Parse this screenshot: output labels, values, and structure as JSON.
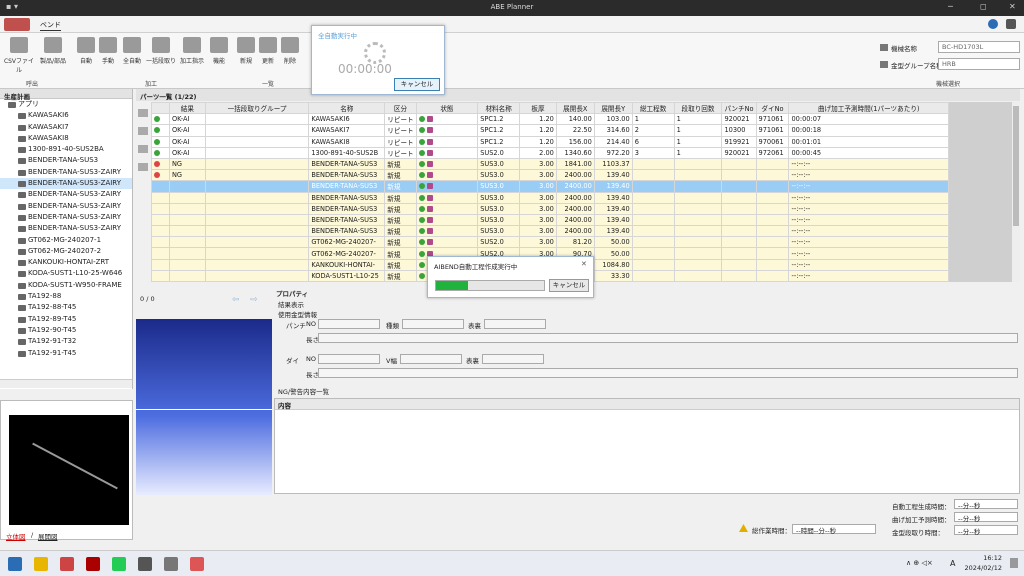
{
  "app": {
    "title": "ABE Planner",
    "win_min": "─",
    "win_max": "◻",
    "win_close": "✕"
  },
  "ribbon": {
    "tab": "ベンド",
    "buttons": [
      "CSVファイル",
      "製品/部品",
      "自動",
      "手動",
      "全自動",
      "一括段取り",
      "加工指示",
      "機能",
      "新規",
      "更新",
      "削除"
    ],
    "groups": {
      "g1": "呼出",
      "g2": "加工",
      "g3": "一覧",
      "g4": "機械選択"
    },
    "machine_label": "機械名称",
    "machine_value": "BC-HD1703L",
    "diegroup_label": "金型グループ名称",
    "diegroup_value": "HRB"
  },
  "left": {
    "header": "生産計画",
    "root": "アプリ",
    "items": [
      "KAWASAKI6",
      "KAWASAKI7",
      "KAWASAKI8",
      "1300-891-40-SUS2BA",
      "BENDER-TANA-SUS3",
      "BENDER-TANA-SUS3-ZAIRY",
      "BENDER-TANA-SUS3-ZAIRY",
      "BENDER-TANA-SUS3-ZAIRY",
      "BENDER-TANA-SUS3-ZAIRY",
      "BENDER-TANA-SUS3-ZAIRY",
      "BENDER-TANA-SUS3-ZAIRY",
      "GT062-MG-240207-1",
      "GT062-MG-240207-2",
      "KANKOUKI-HONTAI-ZRT",
      "KODA-SUST1-L10-25-W646",
      "KODA-SUST1-W950-FRAME",
      "TA192-88",
      "TA192-88-T45",
      "TA192-89-T45",
      "TA192-90-T45",
      "TA192-91-T32",
      "TA192-91-T45"
    ],
    "view_tab1": "立体図",
    "view_sep": "/",
    "view_tab2": "展開図"
  },
  "parts": {
    "header": "パーツ一覧 (1/22)",
    "columns": [
      "結果",
      "一括段取りグループ",
      "名称",
      "区分",
      "状態",
      "材料名称",
      "板厚",
      "展開長X",
      "展開長Y",
      "総工程数",
      "段取り回数",
      "パンチNo",
      "ダイNo",
      "曲げ加工予測時間(1パーツあたり)"
    ],
    "rows": [
      [
        "OK-AI",
        "",
        "KAWASAKI6",
        "リピート",
        "",
        "SPC1.2",
        "1.20",
        "140.00",
        "103.00",
        "1",
        "1",
        "920021",
        "971061",
        "00:00:07"
      ],
      [
        "OK-AI",
        "",
        "KAWASAKI7",
        "リピート",
        "",
        "SPC1.2",
        "1.20",
        "22.50",
        "314.60",
        "2",
        "1",
        "10300",
        "971061",
        "00:00:18"
      ],
      [
        "OK-AI",
        "",
        "KAWASAKI8",
        "リピート",
        "",
        "SPC1.2",
        "1.20",
        "156.00",
        "214.40",
        "6",
        "1",
        "919921",
        "970061",
        "00:01:01"
      ],
      [
        "OK-AI",
        "",
        "1300-891-40-SUS2B",
        "リピート",
        "",
        "SUS2.0",
        "2.00",
        "1340.60",
        "972.20",
        "3",
        "1",
        "920021",
        "972061",
        "00:00:45"
      ],
      [
        "NG",
        "",
        "BENDER-TANA-SUS3",
        "新規",
        "",
        "SUS3.0",
        "3.00",
        "1841.00",
        "1103.37",
        "",
        "",
        "",
        "",
        "--:--:--"
      ],
      [
        "NG",
        "",
        "BENDER-TANA-SUS3",
        "新規",
        "",
        "SUS3.0",
        "3.00",
        "2400.00",
        "139.40",
        "",
        "",
        "",
        "",
        "--:--:--"
      ],
      [
        "",
        "",
        "BENDER-TANA-SUS3",
        "新規",
        "",
        "SUS3.0",
        "3.00",
        "2400.00",
        "139.40",
        "",
        "",
        "",
        "",
        "--:--:--"
      ],
      [
        "",
        "",
        "BENDER-TANA-SUS3",
        "新規",
        "",
        "SUS3.0",
        "3.00",
        "2400.00",
        "139.40",
        "",
        "",
        "",
        "",
        "--:--:--"
      ],
      [
        "",
        "",
        "BENDER-TANA-SUS3",
        "新規",
        "",
        "SUS3.0",
        "3.00",
        "2400.00",
        "139.40",
        "",
        "",
        "",
        "",
        "--:--:--"
      ],
      [
        "",
        "",
        "BENDER-TANA-SUS3",
        "新規",
        "",
        "SUS3.0",
        "3.00",
        "2400.00",
        "139.40",
        "",
        "",
        "",
        "",
        "--:--:--"
      ],
      [
        "",
        "",
        "BENDER-TANA-SUS3",
        "新規",
        "",
        "SUS3.0",
        "3.00",
        "2400.00",
        "139.40",
        "",
        "",
        "",
        "",
        "--:--:--"
      ],
      [
        "",
        "",
        "GT062-MG-240207-",
        "新規",
        "",
        "SUS2.0",
        "3.00",
        "81.20",
        "50.00",
        "",
        "",
        "",
        "",
        "--:--:--"
      ],
      [
        "",
        "",
        "GT062-MG-240207-",
        "新規",
        "",
        "SUS2.0",
        "3.00",
        "90.70",
        "50.00",
        "",
        "",
        "",
        "",
        "--:--:--"
      ],
      [
        "",
        "",
        "KANKOUKI-HONTAI-",
        "新規",
        "",
        "",
        "",
        "588.23",
        "1084.80",
        "",
        "",
        "",
        "",
        "--:--:--"
      ],
      [
        "",
        "",
        "KODA-SUST1-L10-25",
        "新規",
        "",
        "",
        "",
        "646.00",
        "33.30",
        "",
        "",
        "",
        "",
        "--:--:--"
      ]
    ]
  },
  "pager": "0 / 0",
  "props": {
    "header": "プロパティ",
    "result": "結果表示",
    "tooling": "使用金型情報",
    "punch": "パンチ",
    "die": "ダイ",
    "no": "NO",
    "type": "種類",
    "surface": "表裏",
    "length": "長さ",
    "vwidth": "V幅",
    "ng_list": "NG/警告内容一覧",
    "content": "内容"
  },
  "bottom": {
    "total_work": "総作業時間：",
    "total_val": "--時間--分--秒",
    "auto_gen": "自動工程生成時間：",
    "auto_val": "--分--秒",
    "bend_pred": "曲げ加工予測時間：",
    "bend_val": "--分--秒",
    "die_setup": "金型段取り時間：",
    "die_val": "--分--秒"
  },
  "dialog1": {
    "title": "全自動実行中",
    "timer": "00:00:00",
    "cancel": "キャンセル"
  },
  "dialog2": {
    "title": "AIBEND自動工程作成実行中",
    "cancel": "キャンセル",
    "progress": 0.3
  },
  "taskbar": {
    "time": "16:12",
    "date": "2024/02/12",
    "ime": "A"
  }
}
